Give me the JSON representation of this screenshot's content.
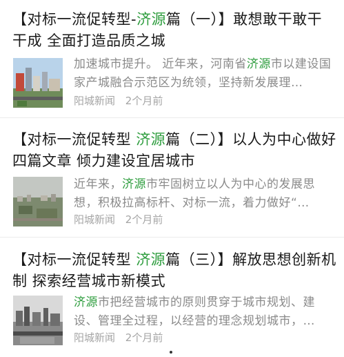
{
  "articles": [
    {
      "title_pre": "【对标一流促转型-",
      "title_kw": "济源",
      "title_post": "篇（一）】敢想敢干敢干干成 全面打造品质之城",
      "snippet_pre": "加速城市提升。 近年来，河南省",
      "snippet_kw": "济源",
      "snippet_post": "市以建设国家产城融合示范区为统领，坚持新发展理…",
      "source": "阳城新闻",
      "time": "2个月前",
      "thumb_icon": "city-skyline-photo"
    },
    {
      "title_pre": "【对标一流促转型 ",
      "title_kw": "济源",
      "title_post": "篇（二）】以人为中心做好四篇文章 倾力建设宜居城市",
      "snippet_pre": "近年来，",
      "snippet_kw": "济源",
      "snippet_post": "市牢固树立以人为中心的发展思想，积极拉高标杆、对标一流，着力做好“…",
      "source": "阳城新闻",
      "time": "2个月前",
      "thumb_icon": "aerial-city-photo"
    },
    {
      "title_pre": "【对标一流促转型 ",
      "title_kw": "济源",
      "title_post": "篇（三）】解放思想创新机制 探索经营城市新模式",
      "snippet_pre": "",
      "snippet_kw": "济源",
      "snippet_post": "市把经营城市的原则贯穿于城市规划、建设、管理全过程，以经营的理念规划城市，…",
      "source": "阳城新闻",
      "time": "2个月前",
      "thumb_icon": "bw-city-photo"
    }
  ],
  "colors": {
    "keyword": "#2e9d3e",
    "snippet": "#8a8a8a",
    "meta": "#a5a5a5"
  }
}
